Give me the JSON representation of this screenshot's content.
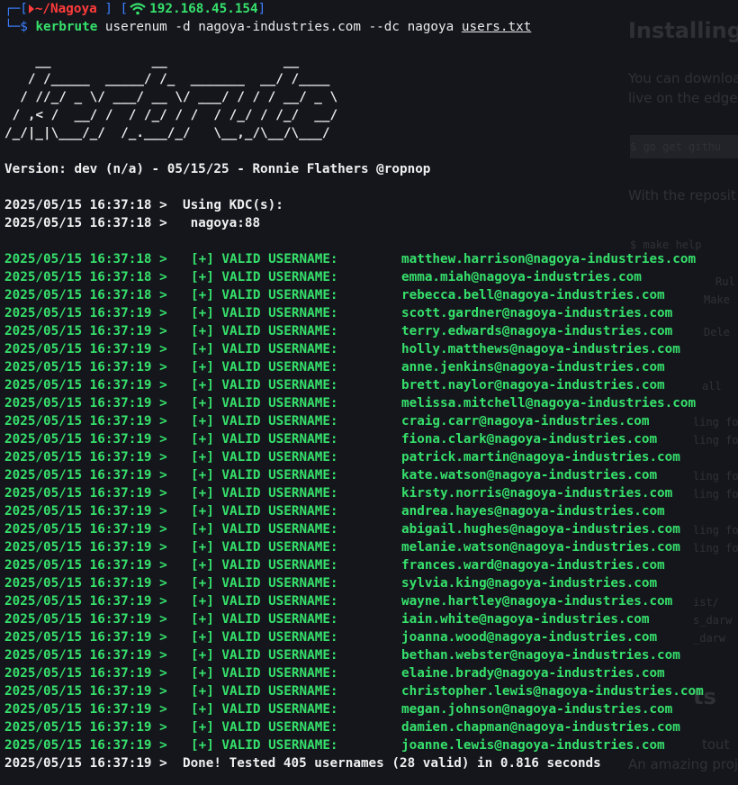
{
  "background_page": {
    "heading": "Installing",
    "lines": [
      "You can download",
      "live on the edge",
      "$ go get githu",
      "With the reposit",
      "$ make help",
      "Rul",
      "Make",
      "Dele",
      "all",
      "ling for",
      "ling for",
      "ling for",
      "ling for",
      "ling for",
      "ling for",
      "ist/",
      "s_darw",
      "_darw",
      "ts",
      "tout",
      "An amazing proj"
    ]
  },
  "prompt": {
    "left_bracket": "[",
    "arrow_icon": "triangle-right-icon",
    "path": "~/Nagoya",
    "right_bracket": "]",
    "ip_left_bracket": "[",
    "wifi_icon": "wifi-icon",
    "ip": "192.168.45.154",
    "ip_right_bracket": "]",
    "command": "kerbrute",
    "args": " userenum -d nagoya-industries.com --dc nagoya ",
    "file": "users.txt"
  },
  "banner": "    __             __               __     \n   / /_____  _____/ /_  _______  __/ /____ \n  / //_/ _ \\/ ___/ __ \\/ ___/ / / / __/ _ \\\n / ,< /  __/ /  / /_/ / /  / /_/ / /_/  __/\n/_/|_|\\___/_/  /_.___/_/   \\__,_/\\__/\\___/ ",
  "version": "Version: dev (n/a) - 05/15/25 - Ronnie Flathers @ropnop",
  "kdc_lines": [
    "2025/05/15 16:37:18 >  Using KDC(s):",
    "2025/05/15 16:37:18 >   nagoya:88"
  ],
  "status_label": "[+] VALID USERNAME:",
  "results": [
    {
      "ts": "2025/05/15 16:37:18 >",
      "email": "matthew.harrison@nagoya-industries.com"
    },
    {
      "ts": "2025/05/15 16:37:18 >",
      "email": "emma.miah@nagoya-industries.com"
    },
    {
      "ts": "2025/05/15 16:37:18 >",
      "email": "rebecca.bell@nagoya-industries.com"
    },
    {
      "ts": "2025/05/15 16:37:19 >",
      "email": "scott.gardner@nagoya-industries.com"
    },
    {
      "ts": "2025/05/15 16:37:19 >",
      "email": "terry.edwards@nagoya-industries.com"
    },
    {
      "ts": "2025/05/15 16:37:19 >",
      "email": "holly.matthews@nagoya-industries.com"
    },
    {
      "ts": "2025/05/15 16:37:19 >",
      "email": "anne.jenkins@nagoya-industries.com"
    },
    {
      "ts": "2025/05/15 16:37:19 >",
      "email": "brett.naylor@nagoya-industries.com"
    },
    {
      "ts": "2025/05/15 16:37:19 >",
      "email": "melissa.mitchell@nagoya-industries.com"
    },
    {
      "ts": "2025/05/15 16:37:19 >",
      "email": "craig.carr@nagoya-industries.com"
    },
    {
      "ts": "2025/05/15 16:37:19 >",
      "email": "fiona.clark@nagoya-industries.com"
    },
    {
      "ts": "2025/05/15 16:37:19 >",
      "email": "patrick.martin@nagoya-industries.com"
    },
    {
      "ts": "2025/05/15 16:37:19 >",
      "email": "kate.watson@nagoya-industries.com"
    },
    {
      "ts": "2025/05/15 16:37:19 >",
      "email": "kirsty.norris@nagoya-industries.com"
    },
    {
      "ts": "2025/05/15 16:37:19 >",
      "email": "andrea.hayes@nagoya-industries.com"
    },
    {
      "ts": "2025/05/15 16:37:19 >",
      "email": "abigail.hughes@nagoya-industries.com"
    },
    {
      "ts": "2025/05/15 16:37:19 >",
      "email": "melanie.watson@nagoya-industries.com"
    },
    {
      "ts": "2025/05/15 16:37:19 >",
      "email": "frances.ward@nagoya-industries.com"
    },
    {
      "ts": "2025/05/15 16:37:19 >",
      "email": "sylvia.king@nagoya-industries.com"
    },
    {
      "ts": "2025/05/15 16:37:19 >",
      "email": "wayne.hartley@nagoya-industries.com"
    },
    {
      "ts": "2025/05/15 16:37:19 >",
      "email": "iain.white@nagoya-industries.com"
    },
    {
      "ts": "2025/05/15 16:37:19 >",
      "email": "joanna.wood@nagoya-industries.com"
    },
    {
      "ts": "2025/05/15 16:37:19 >",
      "email": "bethan.webster@nagoya-industries.com"
    },
    {
      "ts": "2025/05/15 16:37:19 >",
      "email": "elaine.brady@nagoya-industries.com"
    },
    {
      "ts": "2025/05/15 16:37:19 >",
      "email": "christopher.lewis@nagoya-industries.com"
    },
    {
      "ts": "2025/05/15 16:37:19 >",
      "email": "megan.johnson@nagoya-industries.com"
    },
    {
      "ts": "2025/05/15 16:37:19 >",
      "email": "damien.chapman@nagoya-industries.com"
    },
    {
      "ts": "2025/05/15 16:37:19 >",
      "email": "joanne.lewis@nagoya-industries.com"
    }
  ],
  "done_line": "2025/05/15 16:37:19 >  Done! Tested 405 usernames (28 valid) in 0.816 seconds",
  "colors": {
    "background": "#14161c",
    "green": "#36e06b",
    "red": "#ff3b3b",
    "blue": "#3d7fff",
    "text": "#eaeaea"
  }
}
